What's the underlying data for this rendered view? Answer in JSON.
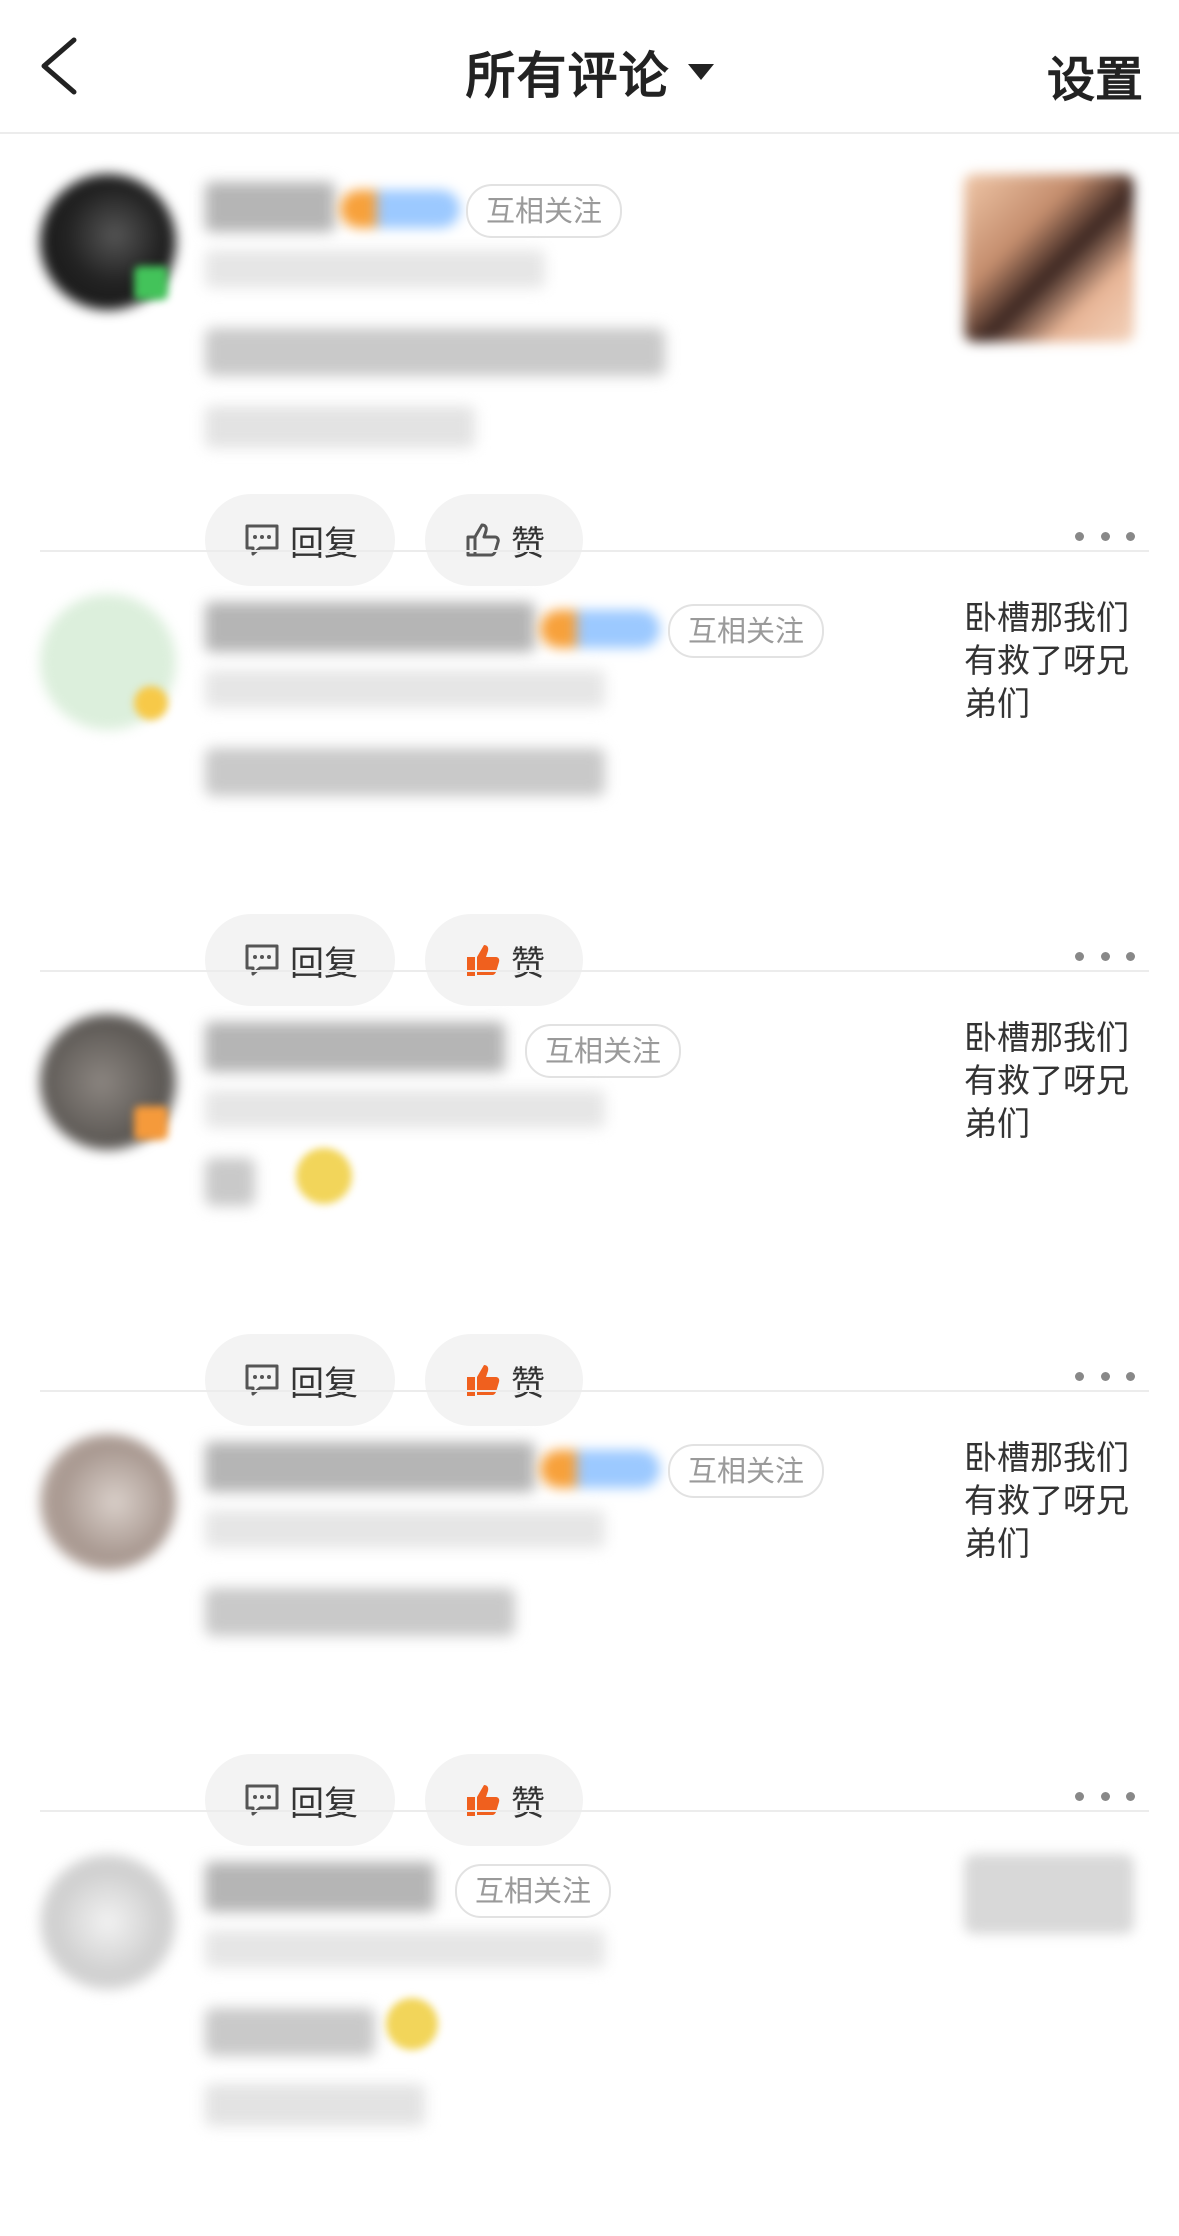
{
  "header": {
    "title": "所有评论",
    "settings": "设置"
  },
  "comments": [
    {
      "mutual_label": "互相关注",
      "reply_label": "回复",
      "like_label": "赞",
      "liked": false,
      "side_text": "",
      "avatar_color": "#1a1a1a",
      "badge_color": "#43c35a"
    },
    {
      "mutual_label": "互相关注",
      "reply_label": "回复",
      "like_label": "赞",
      "liked": true,
      "side_text": "卧槽那我们有救了呀兄弟们",
      "avatar_color": "#dcefdc",
      "badge_color": "#f7c948"
    },
    {
      "mutual_label": "互相关注",
      "reply_label": "回复",
      "like_label": "赞",
      "liked": true,
      "side_text": "卧槽那我们有救了呀兄弟们",
      "avatar_color": "#6d6a66",
      "badge_color": "#f59a3b"
    },
    {
      "mutual_label": "互相关注",
      "reply_label": "回复",
      "like_label": "赞",
      "liked": true,
      "side_text": "卧槽那我们有救了呀兄弟们",
      "avatar_color": "#b8aaa3",
      "badge_color": ""
    },
    {
      "mutual_label": "互相关注",
      "reply_label": "",
      "like_label": "",
      "liked": false,
      "side_text": "",
      "avatar_color": "#cfcfcf",
      "badge_color": ""
    }
  ],
  "colors": {
    "like_active": "#f0601e",
    "icon_default": "#555555",
    "vip_orange": "#f7a13b",
    "vip_blue": "#9cc9ff"
  }
}
